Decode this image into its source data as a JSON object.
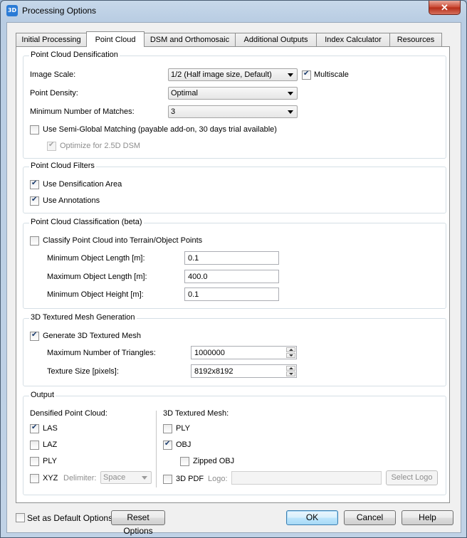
{
  "window": {
    "title": "Processing Options",
    "icon_text": "3D",
    "close_symbol": "✕"
  },
  "tabs": [
    "Initial Processing",
    "Point Cloud",
    "DSM and Orthomosaic",
    "Additional Outputs",
    "Index Calculator",
    "Resources"
  ],
  "active_tab": "Point Cloud",
  "densification": {
    "title": "Point Cloud Densification",
    "image_scale_label": "Image Scale:",
    "image_scale_value": "1/2 (Half image size, Default)",
    "multiscale_label": "Multiscale",
    "multiscale_checked": true,
    "point_density_label": "Point Density:",
    "point_density_value": "Optimal",
    "min_matches_label": "Minimum Number of Matches:",
    "min_matches_value": "3",
    "sgm_label": "Use Semi-Global Matching (payable add-on, 30 days trial available)",
    "sgm_checked": false,
    "optimize_label": "Optimize for 2.5D DSM",
    "optimize_checked": true
  },
  "filters": {
    "title": "Point Cloud Filters",
    "densification_area_label": "Use Densification Area",
    "densification_area_checked": true,
    "annotations_label": "Use Annotations",
    "annotations_checked": true
  },
  "classification": {
    "title": "Point Cloud Classification (beta)",
    "classify_label": "Classify Point Cloud into Terrain/Object Points",
    "classify_checked": false,
    "min_length_label": "Minimum Object Length [m]:",
    "min_length_value": "0.1",
    "max_length_label": "Maximum Object Length [m]:",
    "max_length_value": "400.0",
    "min_height_label": "Minimum Object Height [m]:",
    "min_height_value": "0.1"
  },
  "mesh": {
    "title": "3D Textured Mesh Generation",
    "generate_label": "Generate 3D Textured Mesh",
    "generate_checked": true,
    "max_triangles_label": "Maximum Number of Triangles:",
    "max_triangles_value": "1000000",
    "texture_size_label": "Texture Size [pixels]:",
    "texture_size_value": "8192x8192"
  },
  "output": {
    "title": "Output",
    "densified_title": "Densified Point Cloud:",
    "las_label": "LAS",
    "las_checked": true,
    "laz_label": "LAZ",
    "laz_checked": false,
    "ply_label": "PLY",
    "ply_checked": false,
    "xyz_label": "XYZ",
    "xyz_checked": false,
    "delimiter_label": "Delimiter:",
    "delimiter_value": "Space",
    "mesh_title": "3D Textured Mesh:",
    "mesh_ply_label": "PLY",
    "mesh_ply_checked": false,
    "obj_label": "OBJ",
    "obj_checked": true,
    "zipped_obj_label": "Zipped OBJ",
    "zipped_obj_checked": false,
    "pdf_label": "3D PDF",
    "pdf_checked": false,
    "logo_label": "Logo:",
    "logo_value": "",
    "select_logo_label": "Select Logo"
  },
  "footer": {
    "default_options_label": "Set as Default Options",
    "default_options_checked": false,
    "reset_label": "Reset Options",
    "ok_label": "OK",
    "cancel_label": "Cancel",
    "help_label": "Help"
  }
}
